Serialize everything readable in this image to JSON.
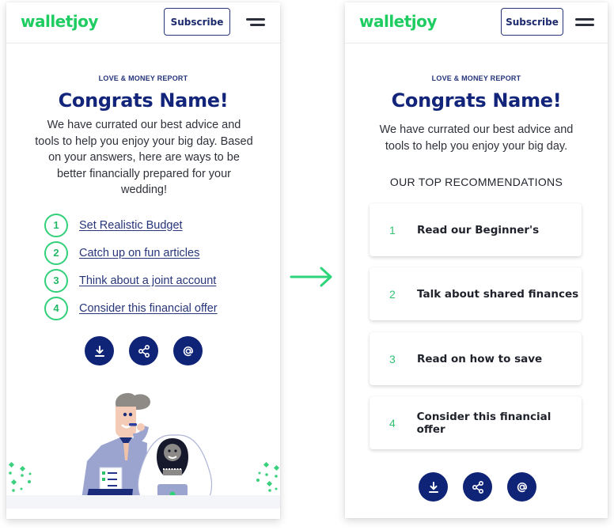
{
  "brand": {
    "name": "walletjoy",
    "color": "#22c55e",
    "accent": "#13257a"
  },
  "before": {
    "header": {
      "logo": "walletjoy",
      "subscribe_label": "Subscribe",
      "menu_icon": "hamburger-icon"
    },
    "kicker": "LOVE & MONEY REPORT",
    "title": "Congrats Name!",
    "intro": "We have currated our best advice and tools to help you enjoy your big day. Based on your answers, here are ways to be better financially prepared for your wedding!",
    "recommendations": [
      {
        "num": "1",
        "label": "Set Realistic Budget"
      },
      {
        "num": "2",
        "label": "Catch up on fun articles"
      },
      {
        "num": "3",
        "label": "Think about a joint account"
      },
      {
        "num": "4",
        "label": "Consider this financial offer"
      }
    ],
    "actions": [
      {
        "icon": "download-icon",
        "label": "Download"
      },
      {
        "icon": "share-icon",
        "label": "Share"
      },
      {
        "icon": "email-icon",
        "label": "Email"
      }
    ],
    "illustration": "wedding-couple-illustration"
  },
  "transition": {
    "icon": "arrow-right-icon",
    "color": "#2ed47a"
  },
  "after": {
    "header": {
      "logo": "walletjoy",
      "subscribe_label": "Subscribe",
      "menu_icon": "hamburger-icon"
    },
    "kicker": "LOVE & MONEY REPORT",
    "title": "Congrats Name!",
    "intro": "We have currated our best advice and tools to help you enjoy your big day.",
    "section_title": "OUR TOP RECOMMENDATIONS",
    "recommendations": [
      {
        "num": "1",
        "label": "Read our Beginner's"
      },
      {
        "num": "2",
        "label": "Talk about shared finances"
      },
      {
        "num": "3",
        "label": "Read on how to save"
      },
      {
        "num": "4",
        "label": "Consider this financial offer"
      }
    ],
    "actions": [
      {
        "icon": "download-icon",
        "label": "Download"
      },
      {
        "icon": "share-icon",
        "label": "Share"
      },
      {
        "icon": "email-icon",
        "label": "Email"
      }
    ]
  }
}
